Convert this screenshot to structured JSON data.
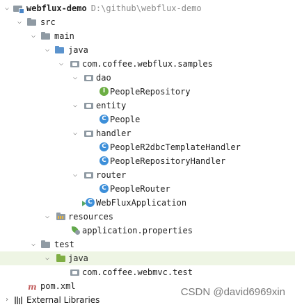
{
  "project": {
    "name": "webflux-demo",
    "path": "D:\\github\\webflux-demo"
  },
  "tree": {
    "src": "src",
    "main": "main",
    "java": "java",
    "package": "com.coffee.webflux.samples",
    "dao": "dao",
    "people_repository": "PeopleRepository",
    "entity": "entity",
    "people": "People",
    "handler": "handler",
    "people_r2dbc_handler": "PeopleR2dbcTemplateHandler",
    "people_repository_handler": "PeopleRepositoryHandler",
    "router": "router",
    "people_router": "PeopleRouter",
    "app": "WebFluxApplication",
    "resources": "resources",
    "application_properties": "application.properties",
    "test": "test",
    "test_java": "java",
    "test_package": "com.coffee.webmvc.test",
    "pom": "pom.xml",
    "external_libraries": "External Libraries"
  },
  "icons": {
    "class_letter": "C",
    "interface_letter": "I",
    "maven_letter": "m"
  },
  "watermark": "CSDN @david6969xin"
}
